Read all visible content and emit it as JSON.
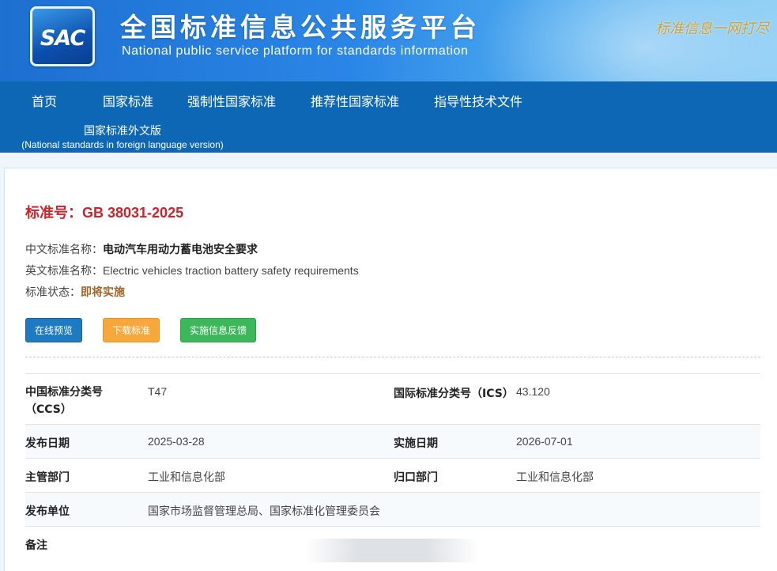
{
  "header": {
    "logo_text": "SAC",
    "title": "全国标准信息公共服务平台",
    "subtitle": "National public service platform  for standards information",
    "slogan": "标准信息一网打尽"
  },
  "nav": {
    "items": [
      "首页",
      "国家标准",
      "强制性国家标准",
      "推荐性国家标准",
      "指导性技术文件"
    ],
    "foreign_zh": "国家标准外文版",
    "foreign_en": "(National standards in foreign language version)"
  },
  "standard": {
    "number_label": "标准号：",
    "number": "GB 38031-2025",
    "cn_name_label": "中文标准名称：",
    "cn_name": "电动汽车用动力蓄电池安全要求",
    "en_name_label": "英文标准名称：",
    "en_name": "Electric vehicles traction battery safety requirements",
    "status_label": "标准状态：",
    "status": "即将实施"
  },
  "buttons": {
    "preview": "在线预览",
    "download": "下载标准",
    "feedback": "实施信息反馈"
  },
  "details": {
    "ccs_label_1": "中国标准分类号",
    "ccs_label_2": "（CCS）",
    "ccs": "T47",
    "ics_label": "国际标准分类号（ICS）",
    "ics": "43.120",
    "publish_label": "发布日期",
    "publish_date": "2025-03-28",
    "implement_label": "实施日期",
    "implement_date": "2026-07-01",
    "authority_label": "主管部门",
    "authority": "工业和信息化部",
    "admin_label": "归口部门",
    "admin": "工业和信息化部",
    "issuer_label": "发布单位",
    "issuer": "国家市场监督管理总局、国家标准化管理委员会",
    "remarks_label": "备注"
  },
  "colors": {
    "nav_bg": "#0e67b5",
    "std_number": "#c9252b",
    "status": "#a0662a",
    "btn_blue": "#1f7bc1",
    "btn_orange": "#f7a83a",
    "btn_green": "#3cb85a"
  }
}
